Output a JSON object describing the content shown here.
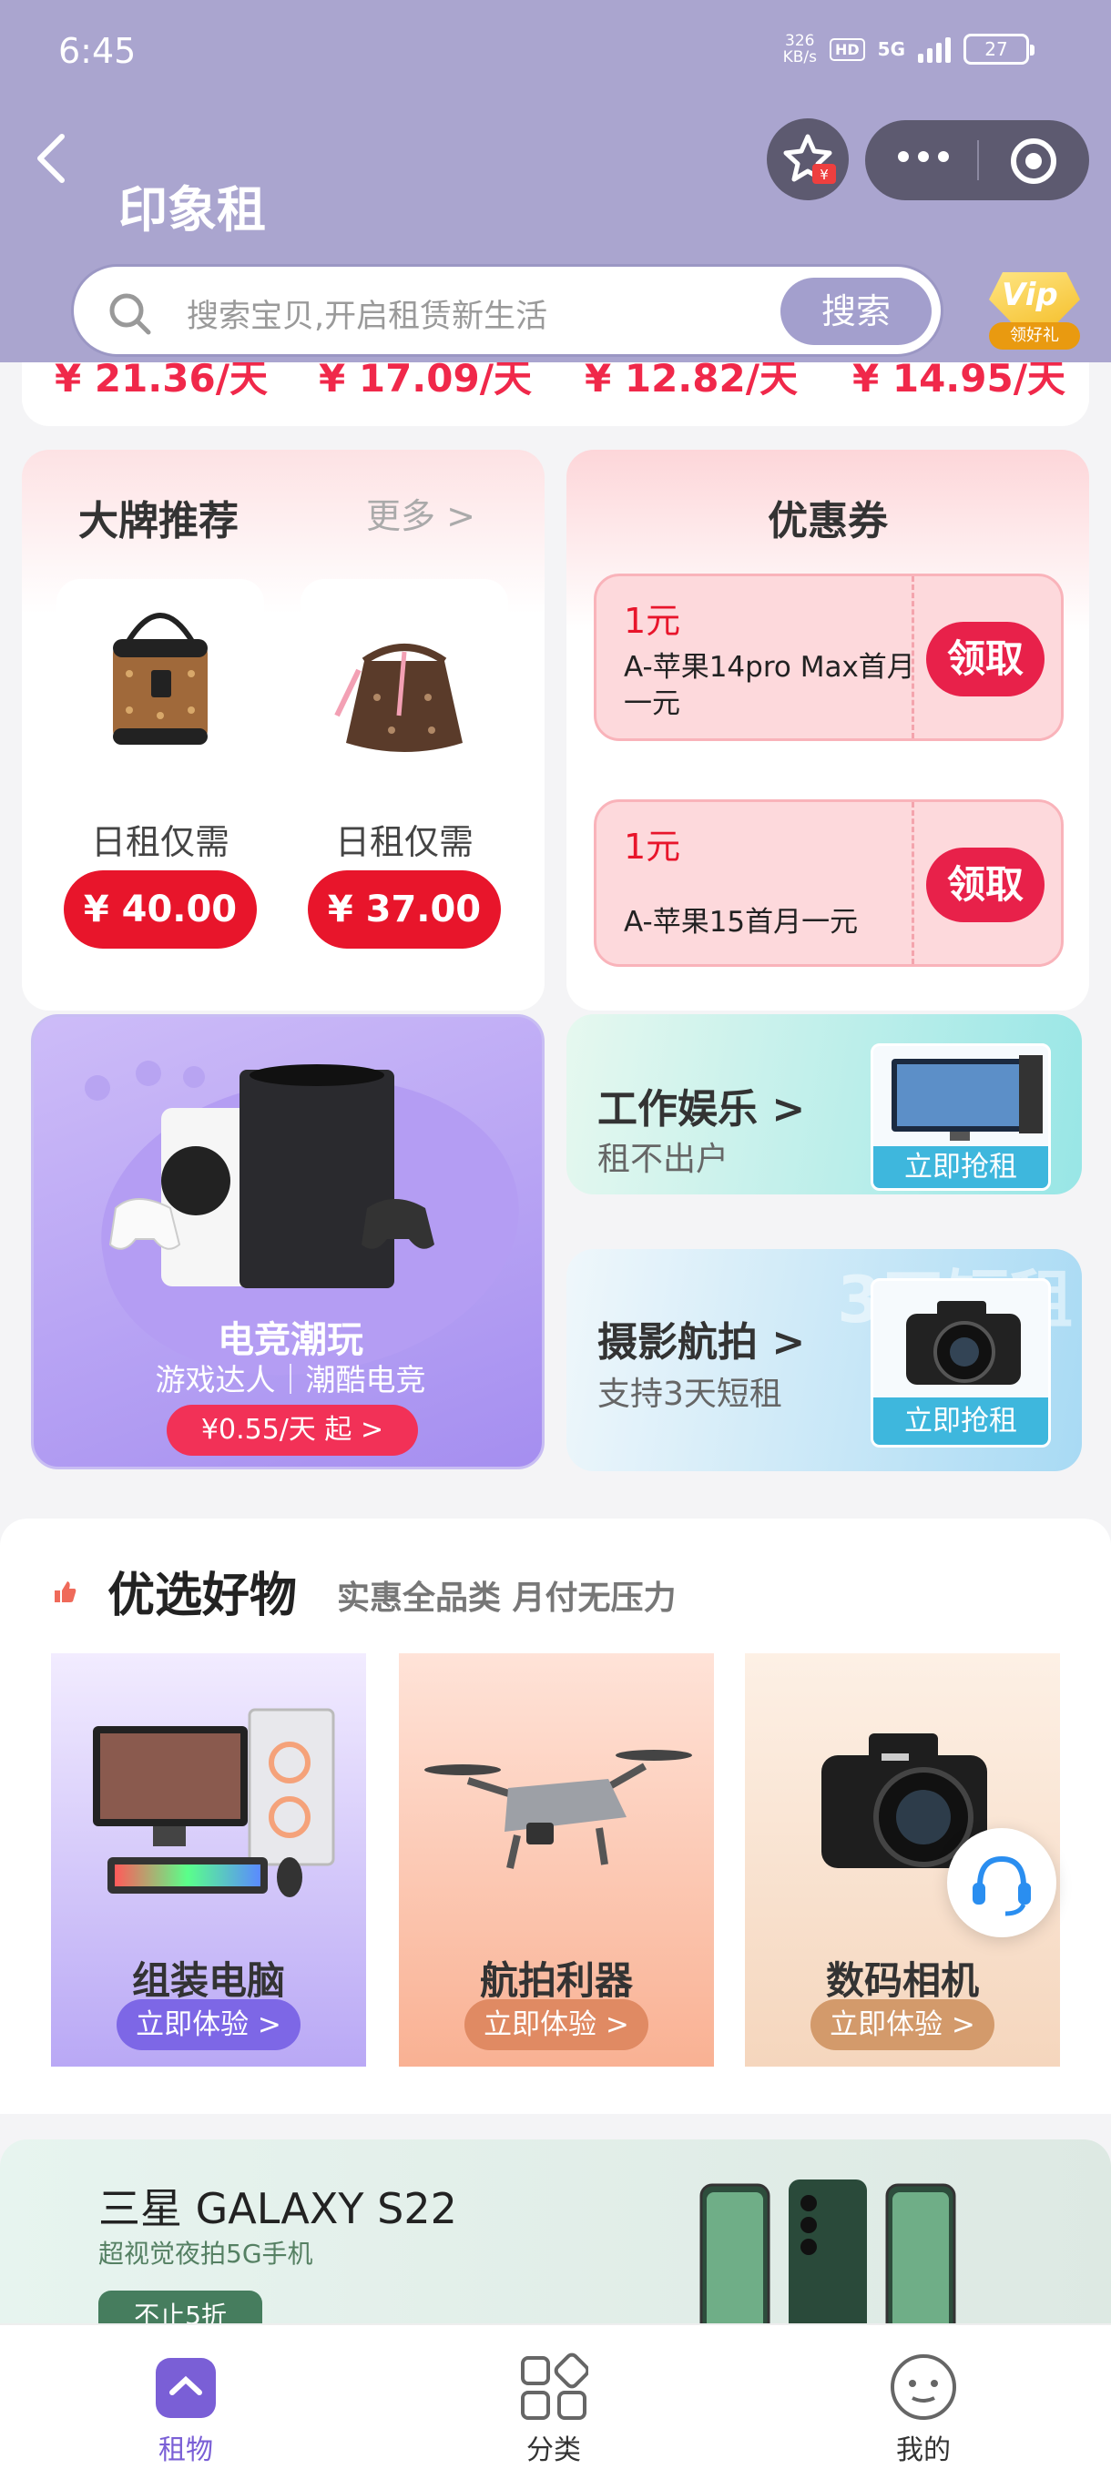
{
  "status": {
    "time": "6:45",
    "speed": "326",
    "speed_unit": "KB/s",
    "hd": "HD",
    "network": "5G",
    "battery": "27"
  },
  "app": {
    "title": "印象租"
  },
  "search": {
    "placeholder": "搜索宝贝,开启租赁新生活",
    "button": "搜索"
  },
  "vip": {
    "badge": "Vip",
    "label": "领好礼"
  },
  "price_strip": [
    "¥ 21.36/天",
    "¥ 17.09/天",
    "¥ 12.82/天",
    "¥ 14.95/天"
  ],
  "brand": {
    "title": "大牌推荐",
    "more": "更多 >",
    "items": [
      {
        "label": "日租仅需",
        "price": "¥ 40.00"
      },
      {
        "label": "日租仅需",
        "price": "¥ 37.00"
      }
    ]
  },
  "coupons": {
    "title": "优惠券",
    "items": [
      {
        "amount": "1元",
        "desc": "A-苹果14pro Max首月一元",
        "action": "领取"
      },
      {
        "amount": "1元",
        "desc": "A-苹果15首月一元",
        "action": "领取"
      }
    ]
  },
  "game": {
    "title": "电竞潮玩",
    "subtitle": "游戏达人｜潮酷电竞",
    "price": "¥0.55/天 起 >"
  },
  "work": {
    "title": "工作娱乐 >",
    "subtitle": "租不出户",
    "cta": "立即抢租"
  },
  "photo": {
    "title": "摄影航拍 >",
    "subtitle": "支持3天短租",
    "cta": "立即抢租",
    "watermark": "3天短租"
  },
  "featured": {
    "title": "优选好物",
    "subtitle": "实惠全品类 月付无压力",
    "tiles": [
      {
        "name": "组装电脑",
        "cta": "立即体验 >",
        "color": "#7d67e6"
      },
      {
        "name": "航拍利器",
        "cta": "立即体验 >",
        "color": "#e08a63"
      },
      {
        "name": "数码相机",
        "cta": "立即体验 >",
        "color": "#d39a6b"
      }
    ]
  },
  "promo": {
    "title": "三星 GALAXY S22",
    "subtitle": "超视觉夜拍5G手机",
    "tag": "不止5折"
  },
  "tabs": [
    {
      "label": "租物",
      "active": true
    },
    {
      "label": "分类",
      "active": false
    },
    {
      "label": "我的",
      "active": false
    }
  ],
  "colors": {
    "header": "#aaa5cf",
    "accent": "#e8152b",
    "tab_active": "#7a5fd6"
  }
}
